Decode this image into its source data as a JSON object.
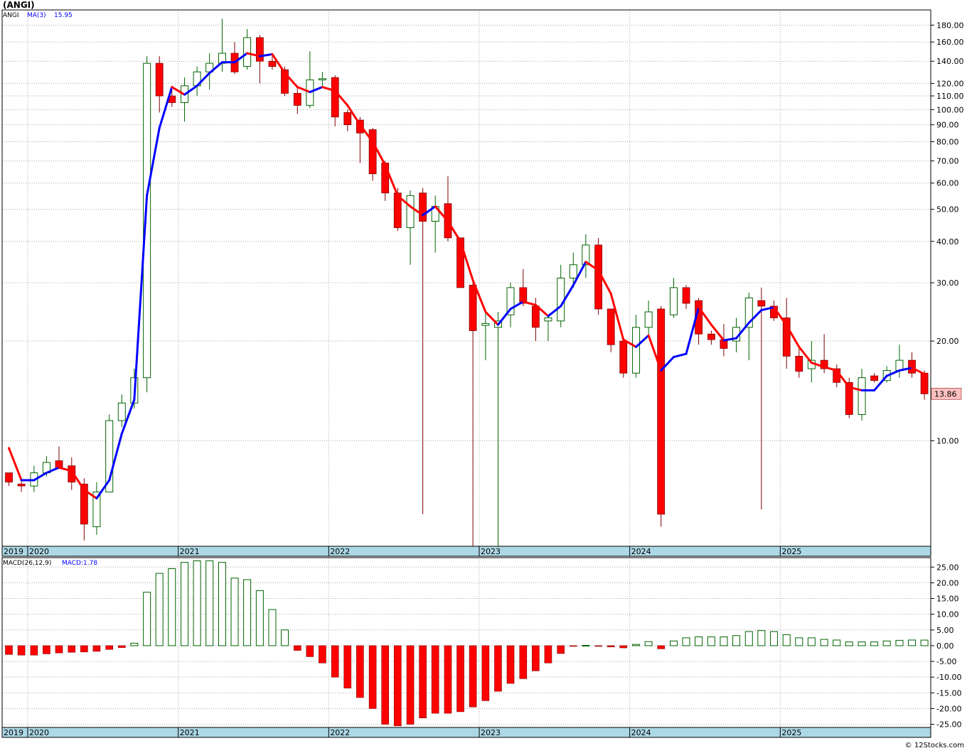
{
  "header": {
    "title": "(ANGI)",
    "copyright": "© 12Stocks.com"
  },
  "colors": {
    "up": "#006400",
    "down": "#ff0000",
    "ma_up": "#0000ff",
    "ma_down": "#ff0000",
    "axis_band": "#add8e6",
    "grid": "#a9a9a9",
    "last_badge": "#ffc0c0"
  },
  "chart_data": [
    {
      "type": "candlestick",
      "symbol": "ANGI",
      "title": "(ANGI)",
      "scale": "log",
      "grid": true,
      "legend": {
        "symbol": "ANGI",
        "ma_label": "MA(3)",
        "ma_value": "15.95"
      },
      "x_ticks": [
        "2019",
        "2020",
        "2021",
        "2022",
        "2023",
        "2024",
        "2025"
      ],
      "x_tick_values": [
        2019.83,
        2020.0,
        2021.0,
        2022.0,
        2023.0,
        2024.0,
        2025.0
      ],
      "x_range": [
        2019.83,
        2026.0
      ],
      "y_ticks": [
        "10.00",
        "20.00",
        "30.00",
        "40.00",
        "50.00",
        "60.00",
        "70.00",
        "80.00",
        "90.00",
        "100.00",
        "110.00",
        "120.00",
        "140.00",
        "160.00",
        "180.00"
      ],
      "ylim": [
        4.8,
        200
      ],
      "last_price": "13.86",
      "candles": [
        {
          "t": 2019.875,
          "o": 8.0,
          "h": 8.0,
          "l": 7.3,
          "c": 7.5
        },
        {
          "t": 2019.958,
          "o": 7.4,
          "h": 7.7,
          "l": 7.0,
          "c": 7.3
        },
        {
          "t": 2020.042,
          "o": 7.3,
          "h": 8.4,
          "l": 7.0,
          "c": 8.0
        },
        {
          "t": 2020.125,
          "o": 8.0,
          "h": 9.0,
          "l": 7.8,
          "c": 8.6
        },
        {
          "t": 2020.208,
          "o": 8.7,
          "h": 9.6,
          "l": 8.2,
          "c": 8.3
        },
        {
          "t": 2020.292,
          "o": 8.4,
          "h": 8.9,
          "l": 7.1,
          "c": 7.5
        },
        {
          "t": 2020.375,
          "o": 7.4,
          "h": 7.7,
          "l": 5.0,
          "c": 5.6
        },
        {
          "t": 2020.458,
          "o": 5.5,
          "h": 7.5,
          "l": 5.2,
          "c": 7.0
        },
        {
          "t": 2020.542,
          "o": 7.0,
          "h": 12.0,
          "l": 7.0,
          "c": 11.5
        },
        {
          "t": 2020.625,
          "o": 11.5,
          "h": 13.8,
          "l": 11.0,
          "c": 13.0
        },
        {
          "t": 2020.708,
          "o": 13.0,
          "h": 16.5,
          "l": 12.5,
          "c": 15.5
        },
        {
          "t": 2020.792,
          "o": 15.5,
          "h": 145.0,
          "l": 14.0,
          "c": 138.0
        },
        {
          "t": 2020.875,
          "o": 138.0,
          "h": 145.0,
          "l": 98.0,
          "c": 110.0
        },
        {
          "t": 2020.958,
          "o": 110.0,
          "h": 118.0,
          "l": 102.0,
          "c": 105.0
        },
        {
          "t": 2021.042,
          "o": 105.0,
          "h": 125.0,
          "l": 92.0,
          "c": 118.0
        },
        {
          "t": 2021.125,
          "o": 118.0,
          "h": 135.0,
          "l": 110.0,
          "c": 130.0
        },
        {
          "t": 2021.208,
          "o": 130.0,
          "h": 148.0,
          "l": 115.0,
          "c": 138.0
        },
        {
          "t": 2021.292,
          "o": 138.0,
          "h": 188.0,
          "l": 130.0,
          "c": 148.0
        },
        {
          "t": 2021.375,
          "o": 148.0,
          "h": 160.0,
          "l": 128.0,
          "c": 130.0
        },
        {
          "t": 2021.458,
          "o": 135.0,
          "h": 175.0,
          "l": 132.0,
          "c": 165.0
        },
        {
          "t": 2021.542,
          "o": 165.0,
          "h": 168.0,
          "l": 120.0,
          "c": 140.0
        },
        {
          "t": 2021.625,
          "o": 140.0,
          "h": 145.0,
          "l": 132.0,
          "c": 135.0
        },
        {
          "t": 2021.708,
          "o": 132.0,
          "h": 135.0,
          "l": 110.0,
          "c": 112.0
        },
        {
          "t": 2021.792,
          "o": 112.0,
          "h": 118.0,
          "l": 97.0,
          "c": 103.0
        },
        {
          "t": 2021.875,
          "o": 103.0,
          "h": 150.0,
          "l": 101.0,
          "c": 123.0
        },
        {
          "t": 2021.958,
          "o": 123.0,
          "h": 130.0,
          "l": 118.0,
          "c": 124.0
        },
        {
          "t": 2022.042,
          "o": 125.0,
          "h": 127.0,
          "l": 89.0,
          "c": 95.0
        },
        {
          "t": 2022.125,
          "o": 98.0,
          "h": 100.0,
          "l": 86.0,
          "c": 90.0
        },
        {
          "t": 2022.208,
          "o": 93.0,
          "h": 95.0,
          "l": 69.0,
          "c": 85.0
        },
        {
          "t": 2022.292,
          "o": 87.0,
          "h": 88.0,
          "l": 61.0,
          "c": 64.0
        },
        {
          "t": 2022.375,
          "o": 69.0,
          "h": 70.0,
          "l": 53.0,
          "c": 56.0
        },
        {
          "t": 2022.458,
          "o": 56.0,
          "h": 58.0,
          "l": 43.0,
          "c": 44.0
        },
        {
          "t": 2022.542,
          "o": 44.0,
          "h": 57.0,
          "l": 34.0,
          "c": 55.0
        },
        {
          "t": 2022.625,
          "o": 56.0,
          "h": 58.0,
          "l": 6.0,
          "c": 46.0
        },
        {
          "t": 2022.708,
          "o": 46.0,
          "h": 55.0,
          "l": 37.0,
          "c": 51.0
        },
        {
          "t": 2022.792,
          "o": 52.0,
          "h": 63.0,
          "l": 40.0,
          "c": 41.0
        },
        {
          "t": 2022.875,
          "o": 41.0,
          "h": 41.0,
          "l": 29.0,
          "c": 29.0
        },
        {
          "t": 2022.958,
          "o": 29.5,
          "h": 30.0,
          "l": 4.8,
          "c": 21.5
        },
        {
          "t": 2023.042,
          "o": 22.3,
          "h": 25.0,
          "l": 17.5,
          "c": 22.6
        },
        {
          "t": 2023.125,
          "o": 22.0,
          "h": 24.5,
          "l": 4.8,
          "c": 23.0
        },
        {
          "t": 2023.208,
          "o": 24.0,
          "h": 30.0,
          "l": 22.0,
          "c": 29.0
        },
        {
          "t": 2023.292,
          "o": 29.0,
          "h": 33.0,
          "l": 25.5,
          "c": 26.0
        },
        {
          "t": 2023.375,
          "o": 25.5,
          "h": 27.0,
          "l": 20.0,
          "c": 22.0
        },
        {
          "t": 2023.458,
          "o": 23.0,
          "h": 24.0,
          "l": 20.0,
          "c": 23.5
        },
        {
          "t": 2023.542,
          "o": 23.0,
          "h": 34.0,
          "l": 22.0,
          "c": 31.0
        },
        {
          "t": 2023.625,
          "o": 31.0,
          "h": 37.0,
          "l": 29.0,
          "c": 34.0
        },
        {
          "t": 2023.708,
          "o": 34.0,
          "h": 42.0,
          "l": 31.0,
          "c": 39.0
        },
        {
          "t": 2023.792,
          "o": 39.0,
          "h": 41.0,
          "l": 24.0,
          "c": 25.0
        },
        {
          "t": 2023.875,
          "o": 25.0,
          "h": 25.0,
          "l": 18.5,
          "c": 19.5
        },
        {
          "t": 2023.958,
          "o": 20.0,
          "h": 20.5,
          "l": 15.5,
          "c": 16.0
        },
        {
          "t": 2024.042,
          "o": 16.0,
          "h": 24.0,
          "l": 15.5,
          "c": 22.0
        },
        {
          "t": 2024.125,
          "o": 22.0,
          "h": 26.5,
          "l": 21.0,
          "c": 24.5
        },
        {
          "t": 2024.208,
          "o": 25.0,
          "h": 25.5,
          "l": 5.5,
          "c": 6.0
        },
        {
          "t": 2024.292,
          "o": 24.0,
          "h": 31.0,
          "l": 23.5,
          "c": 29.0
        },
        {
          "t": 2024.375,
          "o": 29.0,
          "h": 29.5,
          "l": 25.0,
          "c": 26.0
        },
        {
          "t": 2024.458,
          "o": 26.5,
          "h": 27.0,
          "l": 19.5,
          "c": 21.0
        },
        {
          "t": 2024.542,
          "o": 21.0,
          "h": 21.5,
          "l": 19.5,
          "c": 20.2
        },
        {
          "t": 2024.625,
          "o": 20.2,
          "h": 22.5,
          "l": 18.0,
          "c": 19.0
        },
        {
          "t": 2024.708,
          "o": 20.0,
          "h": 23.5,
          "l": 18.5,
          "c": 22.0
        },
        {
          "t": 2024.792,
          "o": 22.0,
          "h": 28.0,
          "l": 17.5,
          "c": 27.0
        },
        {
          "t": 2024.875,
          "o": 26.5,
          "h": 29.0,
          "l": 6.2,
          "c": 25.5
        },
        {
          "t": 2024.958,
          "o": 25.5,
          "h": 26.5,
          "l": 23.0,
          "c": 23.5
        },
        {
          "t": 2025.042,
          "o": 23.5,
          "h": 27.0,
          "l": 16.5,
          "c": 18.0
        },
        {
          "t": 2025.125,
          "o": 18.0,
          "h": 19.0,
          "l": 15.5,
          "c": 16.2
        },
        {
          "t": 2025.208,
          "o": 16.5,
          "h": 20.0,
          "l": 15.0,
          "c": 17.5
        },
        {
          "t": 2025.292,
          "o": 17.5,
          "h": 21.0,
          "l": 16.0,
          "c": 16.5
        },
        {
          "t": 2025.375,
          "o": 16.5,
          "h": 17.0,
          "l": 14.5,
          "c": 15.0
        },
        {
          "t": 2025.458,
          "o": 15.0,
          "h": 15.5,
          "l": 11.7,
          "c": 12.0
        },
        {
          "t": 2025.542,
          "o": 12.0,
          "h": 16.5,
          "l": 11.5,
          "c": 15.5
        },
        {
          "t": 2025.625,
          "o": 15.7,
          "h": 16.0,
          "l": 15.0,
          "c": 15.2
        },
        {
          "t": 2025.708,
          "o": 15.2,
          "h": 16.8,
          "l": 15.0,
          "c": 16.3
        },
        {
          "t": 2025.792,
          "o": 16.3,
          "h": 19.5,
          "l": 15.5,
          "c": 17.5
        },
        {
          "t": 2025.875,
          "o": 17.5,
          "h": 18.5,
          "l": 15.5,
          "c": 16.0
        },
        {
          "t": 2025.958,
          "o": 16.0,
          "h": 16.3,
          "l": 13.3,
          "c": 13.86
        }
      ],
      "ma": [
        {
          "t": 2019.875,
          "v": 9.5
        },
        {
          "t": 2019.958,
          "v": 7.6
        },
        {
          "t": 2020.042,
          "v": 7.6
        },
        {
          "t": 2020.125,
          "v": 8.0
        },
        {
          "t": 2020.208,
          "v": 8.3
        },
        {
          "t": 2020.292,
          "v": 8.1
        },
        {
          "t": 2020.375,
          "v": 7.1
        },
        {
          "t": 2020.458,
          "v": 6.7
        },
        {
          "t": 2020.542,
          "v": 7.6
        },
        {
          "t": 2020.625,
          "v": 10.5
        },
        {
          "t": 2020.708,
          "v": 13.3
        },
        {
          "t": 2020.792,
          "v": 55.0
        },
        {
          "t": 2020.875,
          "v": 88.0
        },
        {
          "t": 2020.958,
          "v": 117.0
        },
        {
          "t": 2021.042,
          "v": 111.0
        },
        {
          "t": 2021.125,
          "v": 118.0
        },
        {
          "t": 2021.208,
          "v": 129.0
        },
        {
          "t": 2021.292,
          "v": 139.0
        },
        {
          "t": 2021.375,
          "v": 139.0
        },
        {
          "t": 2021.458,
          "v": 148.0
        },
        {
          "t": 2021.542,
          "v": 145.0
        },
        {
          "t": 2021.625,
          "v": 147.0
        },
        {
          "t": 2021.708,
          "v": 129.0
        },
        {
          "t": 2021.792,
          "v": 117.0
        },
        {
          "t": 2021.875,
          "v": 113.0
        },
        {
          "t": 2021.958,
          "v": 117.0
        },
        {
          "t": 2022.042,
          "v": 114.0
        },
        {
          "t": 2022.125,
          "v": 103.0
        },
        {
          "t": 2022.208,
          "v": 90.0
        },
        {
          "t": 2022.292,
          "v": 80.0
        },
        {
          "t": 2022.375,
          "v": 68.0
        },
        {
          "t": 2022.458,
          "v": 55.0
        },
        {
          "t": 2022.542,
          "v": 51.0
        },
        {
          "t": 2022.625,
          "v": 48.0
        },
        {
          "t": 2022.708,
          "v": 51.0
        },
        {
          "t": 2022.792,
          "v": 46.0
        },
        {
          "t": 2022.875,
          "v": 40.0
        },
        {
          "t": 2022.958,
          "v": 30.5
        },
        {
          "t": 2023.042,
          "v": 24.5
        },
        {
          "t": 2023.125,
          "v": 22.4
        },
        {
          "t": 2023.208,
          "v": 25.0
        },
        {
          "t": 2023.292,
          "v": 26.3
        },
        {
          "t": 2023.375,
          "v": 25.7
        },
        {
          "t": 2023.458,
          "v": 23.8
        },
        {
          "t": 2023.542,
          "v": 25.5
        },
        {
          "t": 2023.625,
          "v": 29.5
        },
        {
          "t": 2023.708,
          "v": 34.7
        },
        {
          "t": 2023.792,
          "v": 32.7
        },
        {
          "t": 2023.875,
          "v": 27.8
        },
        {
          "t": 2023.958,
          "v": 20.2
        },
        {
          "t": 2024.042,
          "v": 19.2
        },
        {
          "t": 2024.125,
          "v": 20.8
        },
        {
          "t": 2024.208,
          "v": 16.3
        },
        {
          "t": 2024.292,
          "v": 17.9
        },
        {
          "t": 2024.375,
          "v": 18.3
        },
        {
          "t": 2024.458,
          "v": 25.3
        },
        {
          "t": 2024.542,
          "v": 22.4
        },
        {
          "t": 2024.625,
          "v": 20.1
        },
        {
          "t": 2024.708,
          "v": 20.4
        },
        {
          "t": 2024.792,
          "v": 22.7
        },
        {
          "t": 2024.875,
          "v": 24.8
        },
        {
          "t": 2024.958,
          "v": 25.3
        },
        {
          "t": 2025.042,
          "v": 22.3
        },
        {
          "t": 2025.125,
          "v": 19.2
        },
        {
          "t": 2025.208,
          "v": 17.2
        },
        {
          "t": 2025.292,
          "v": 16.7
        },
        {
          "t": 2025.375,
          "v": 16.3
        },
        {
          "t": 2025.458,
          "v": 14.5
        },
        {
          "t": 2025.542,
          "v": 14.2
        },
        {
          "t": 2025.625,
          "v": 14.2
        },
        {
          "t": 2025.708,
          "v": 15.7
        },
        {
          "t": 2025.792,
          "v": 16.3
        },
        {
          "t": 2025.875,
          "v": 16.6
        },
        {
          "t": 2025.958,
          "v": 15.9
        }
      ]
    },
    {
      "type": "bar",
      "title": "MACD(26,12,9)",
      "legend": {
        "label": "MACD(26,12,9)",
        "value_label": "MACD:1.78"
      },
      "x_ticks": [
        "2019",
        "2020",
        "2021",
        "2022",
        "2023",
        "2024",
        "2025"
      ],
      "x_tick_values": [
        2019.83,
        2020.0,
        2021.0,
        2022.0,
        2023.0,
        2024.0,
        2025.0
      ],
      "x_range": [
        2019.83,
        2026.0
      ],
      "y_ticks": [
        "25.00",
        "20.00",
        "15.00",
        "10.00",
        "5.00",
        "0.00",
        "-5.00",
        "-10.00",
        "-15.00",
        "-20.00",
        "-25.00"
      ],
      "y_tick_values": [
        25,
        20,
        15,
        10,
        5,
        0,
        -5,
        -10,
        -15,
        -20,
        -25
      ],
      "ylim": [
        -26,
        28
      ],
      "grid": true,
      "t": [
        2019.875,
        2019.958,
        2020.042,
        2020.125,
        2020.208,
        2020.292,
        2020.375,
        2020.458,
        2020.542,
        2020.625,
        2020.708,
        2020.792,
        2020.875,
        2020.958,
        2021.042,
        2021.125,
        2021.208,
        2021.292,
        2021.375,
        2021.458,
        2021.542,
        2021.625,
        2021.708,
        2021.792,
        2021.875,
        2021.958,
        2022.042,
        2022.125,
        2022.208,
        2022.292,
        2022.375,
        2022.458,
        2022.542,
        2022.625,
        2022.708,
        2022.792,
        2022.875,
        2022.958,
        2023.042,
        2023.125,
        2023.208,
        2023.292,
        2023.375,
        2023.458,
        2023.542,
        2023.625,
        2023.708,
        2023.792,
        2023.875,
        2023.958,
        2024.042,
        2024.125,
        2024.208,
        2024.292,
        2024.375,
        2024.458,
        2024.542,
        2024.625,
        2024.708,
        2024.792,
        2024.875,
        2024.958,
        2025.042,
        2025.125,
        2025.208,
        2025.292,
        2025.375,
        2025.458,
        2025.542,
        2025.625,
        2025.708,
        2025.792,
        2025.875,
        2025.958
      ],
      "values": [
        -2.8,
        -3.0,
        -3.0,
        -2.6,
        -2.3,
        -2.1,
        -2.0,
        -1.8,
        -1.2,
        -0.6,
        0.8,
        17.0,
        23.0,
        24.5,
        26.5,
        27.0,
        27.0,
        26.5,
        21.5,
        21.0,
        17.5,
        11.5,
        5.0,
        -1.5,
        -3.5,
        -5.5,
        -10.0,
        -13.5,
        -16.5,
        -20.0,
        -25.0,
        -25.5,
        -25.0,
        -23.0,
        -21.5,
        -21.5,
        -21.0,
        -19.5,
        -17.5,
        -14.5,
        -12.0,
        -10.5,
        -8.0,
        -5.5,
        -2.5,
        -0.2,
        0.1,
        -0.1,
        -0.4,
        -0.7,
        0.4,
        1.3,
        -1.0,
        1.5,
        2.5,
        2.8,
        2.8,
        2.8,
        3.2,
        4.5,
        4.8,
        4.5,
        3.5,
        2.5,
        2.5,
        2.0,
        1.8,
        1.2,
        1.2,
        1.2,
        1.5,
        1.7,
        1.8,
        1.78
      ]
    }
  ]
}
